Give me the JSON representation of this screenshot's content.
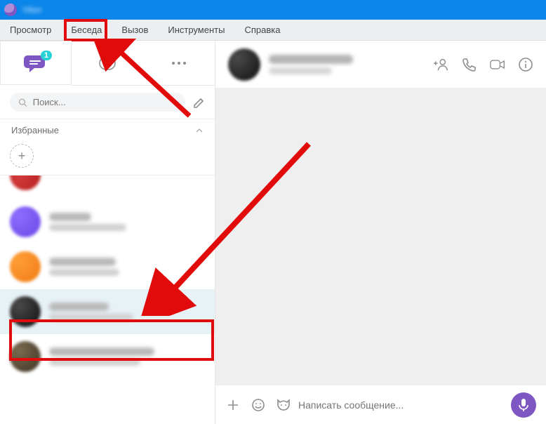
{
  "titlebar": {
    "title": "Viber"
  },
  "menu": {
    "items": [
      "Просмотр",
      "Беседа",
      "Вызов",
      "Инструменты",
      "Справка"
    ],
    "highlighted_index": 1
  },
  "left_tabs": {
    "chat_badge": "1"
  },
  "search": {
    "placeholder": "Поиск..."
  },
  "favorites": {
    "label": "Избранные"
  },
  "chat_header": {
    "add_person_icon": "add-person",
    "call_icon": "phone",
    "video_icon": "video",
    "info_icon": "info"
  },
  "composer": {
    "placeholder": "Написать сообщение...",
    "plus_icon": "plus",
    "smile_icon": "smile",
    "sticker_icon": "cat-face",
    "mic_icon": "mic"
  }
}
